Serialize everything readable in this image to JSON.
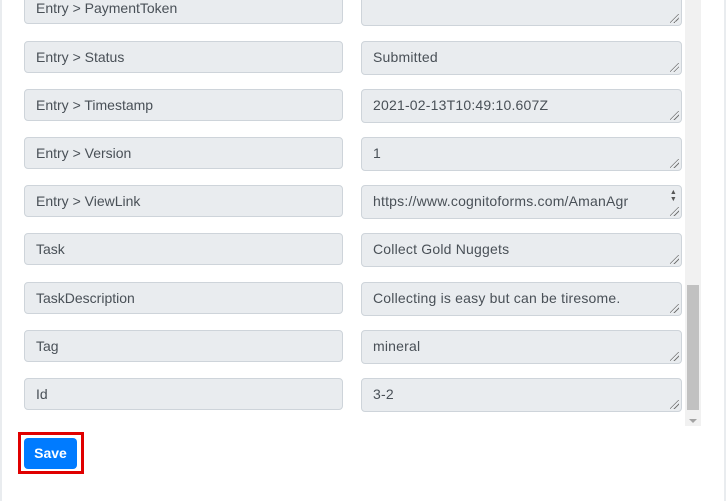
{
  "fields": [
    {
      "label": "Entry > PaymentToken",
      "value": ""
    },
    {
      "label": "Entry > Status",
      "value": "Submitted"
    },
    {
      "label": "Entry > Timestamp",
      "value": "2021-02-13T10:49:10.607Z"
    },
    {
      "label": "Entry > Version",
      "value": "1"
    },
    {
      "label": "Entry > ViewLink",
      "value": "https://www.cognitoforms.com/AmanAgr"
    },
    {
      "label": "Task",
      "value": "Collect Gold Nuggets"
    },
    {
      "label": "TaskDescription",
      "value": "Collecting is easy but can be tiresome."
    },
    {
      "label": "Tag",
      "value": "mineral"
    },
    {
      "label": "Id",
      "value": "3-2"
    }
  ],
  "actions": {
    "save_label": "Save"
  },
  "colors": {
    "primary": "#007bff",
    "highlight": "#e00000",
    "field_bg": "#e9ecef"
  },
  "icons": {
    "resize_grip": "resize-grip-icon",
    "spinner": "spinner-arrows-icon",
    "scroll_down": "scroll-down-arrow-icon"
  }
}
